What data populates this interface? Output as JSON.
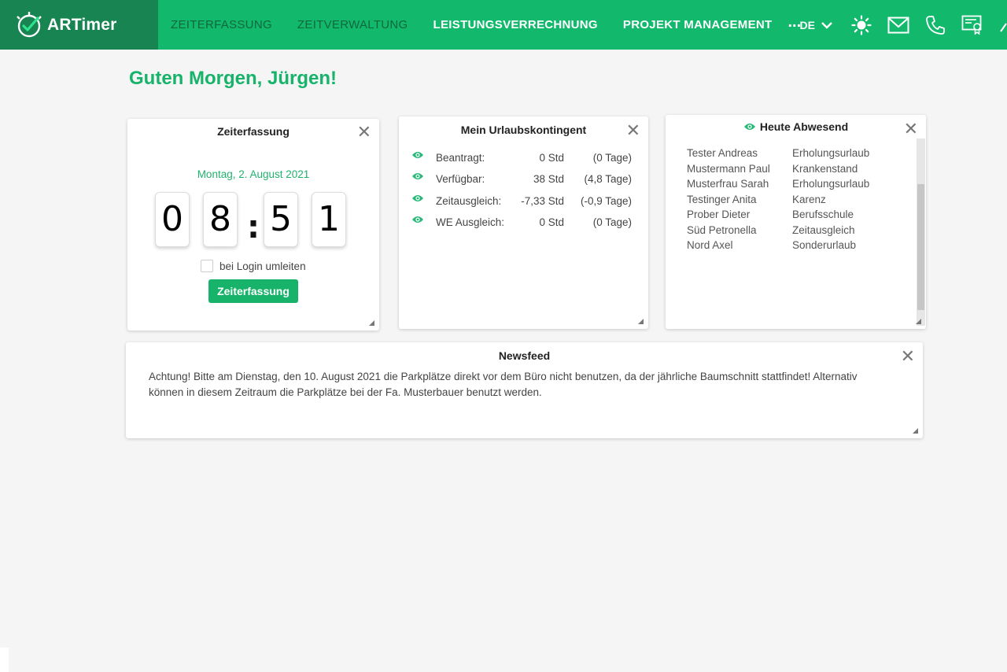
{
  "app": {
    "name": "ARTimer"
  },
  "nav": {
    "items": [
      {
        "label": "ZEITERFASSUNG"
      },
      {
        "label": "ZEITVERWALTUNG"
      },
      {
        "label": "LEISTUNGSVERRECHNUNG"
      },
      {
        "label": "PROJEKT MANAGEMENT"
      }
    ],
    "more": "...",
    "language": "DE"
  },
  "greeting": "Guten Morgen, Jürgen!",
  "zeiterfassung": {
    "title": "Zeiterfassung",
    "date": "Montag, 2. August 2021",
    "digits": [
      "0",
      "8",
      "5",
      "1"
    ],
    "separator": ":",
    "checkbox_label": "bei Login umleiten",
    "checkbox_checked": false,
    "button_label": "Zeiterfassung"
  },
  "urlaub": {
    "title": "Mein Urlaubskontingent",
    "rows": [
      {
        "label": "Beantragt:",
        "std": "0 Std",
        "tage": "(0 Tage)"
      },
      {
        "label": "Verfügbar:",
        "std": "38 Std",
        "tage": "(4,8 Tage)"
      },
      {
        "label": "Zeitausgleich:",
        "std": "-7,33 Std",
        "tage": "(-0,9 Tage)"
      },
      {
        "label": "WE Ausgleich:",
        "std": "0 Std",
        "tage": "(0 Tage)"
      }
    ]
  },
  "abwesend": {
    "title": "Heute Abwesend",
    "rows": [
      {
        "name": "Tester Andreas",
        "reason": "Erholungsurlaub"
      },
      {
        "name": "Mustermann Paul",
        "reason": "Krankenstand"
      },
      {
        "name": "Musterfrau Sarah",
        "reason": "Erholungsurlaub"
      },
      {
        "name": "Testinger Anita",
        "reason": "Karenz"
      },
      {
        "name": "Prober Dieter",
        "reason": "Berufsschule"
      },
      {
        "name": "Süd Petronella",
        "reason": "Zeitausgleich"
      },
      {
        "name": "Nord Axel",
        "reason": "Sonderurlaub"
      }
    ]
  },
  "newsfeed": {
    "title": "Newsfeed",
    "text": "Achtung! Bitte am Dienstag, den 10. August 2021 die Parkplätze direkt vor dem Büro nicht benutzen, da der jährliche Baumschnitt stattfindet! Alternativ können in diesem Zeitraum die Parkplätze bei der Fa. Musterbauer benutzt werden."
  },
  "icons": {
    "close": "close-icon",
    "eye": "eye-icon",
    "sun": "sun-icon",
    "mail": "mail-icon",
    "phone": "phone-icon",
    "certificate": "certificate-icon",
    "chevron": "chevron-down-icon"
  },
  "colors": {
    "header_green": "#12b86c",
    "logo_green": "#178452",
    "accent_green": "#17b36a",
    "background": "#f5f5f6"
  }
}
